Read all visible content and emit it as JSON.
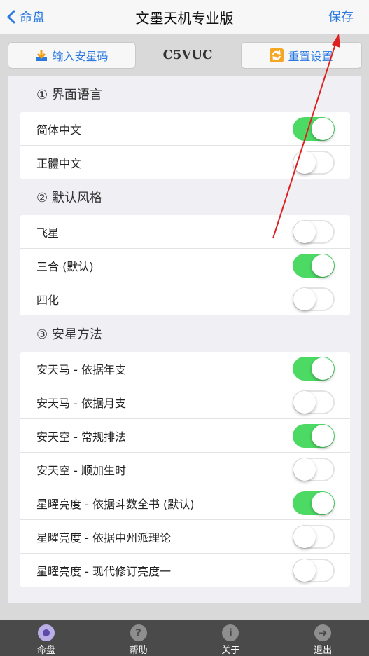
{
  "nav": {
    "back_label": "命盘",
    "title": "文墨天机专业版",
    "save_label": "保存"
  },
  "toolbar": {
    "import_label": "输入安星码",
    "code": "C5VUC",
    "reset_label": "重置设置"
  },
  "sections": [
    {
      "title": "① 界面语言",
      "rows": [
        {
          "label": "简体中文",
          "on": true
        },
        {
          "label": "正體中文",
          "on": false
        }
      ]
    },
    {
      "title": "② 默认风格",
      "rows": [
        {
          "label": "飞星",
          "on": false
        },
        {
          "label": "三合 (默认)",
          "on": true
        },
        {
          "label": "四化",
          "on": false
        }
      ]
    },
    {
      "title": "③ 安星方法",
      "rows": [
        {
          "label": "安天马 - 依据年支",
          "on": true
        },
        {
          "label": "安天马 - 依据月支",
          "on": false
        },
        {
          "label": "安天空 - 常规排法",
          "on": true
        },
        {
          "label": "安天空 - 顺加生时",
          "on": false
        },
        {
          "label": "星曜亮度 - 依据斗数全书 (默认)",
          "on": true
        },
        {
          "label": "星曜亮度 - 依据中州派理论",
          "on": false
        },
        {
          "label": "星曜亮度 - 现代修订亮度一",
          "on": false
        }
      ]
    }
  ],
  "tabbar": {
    "items": [
      {
        "label": "命盘",
        "icon": "chart-disc-icon",
        "active": true
      },
      {
        "label": "帮助",
        "icon": "help-icon",
        "active": false
      },
      {
        "label": "关于",
        "icon": "info-icon",
        "active": false
      },
      {
        "label": "退出",
        "icon": "exit-icon",
        "active": false
      }
    ]
  },
  "colors": {
    "accent": "#2a7ae2",
    "toggle_on": "#4cd964",
    "annotation_arrow": "#e02020"
  }
}
